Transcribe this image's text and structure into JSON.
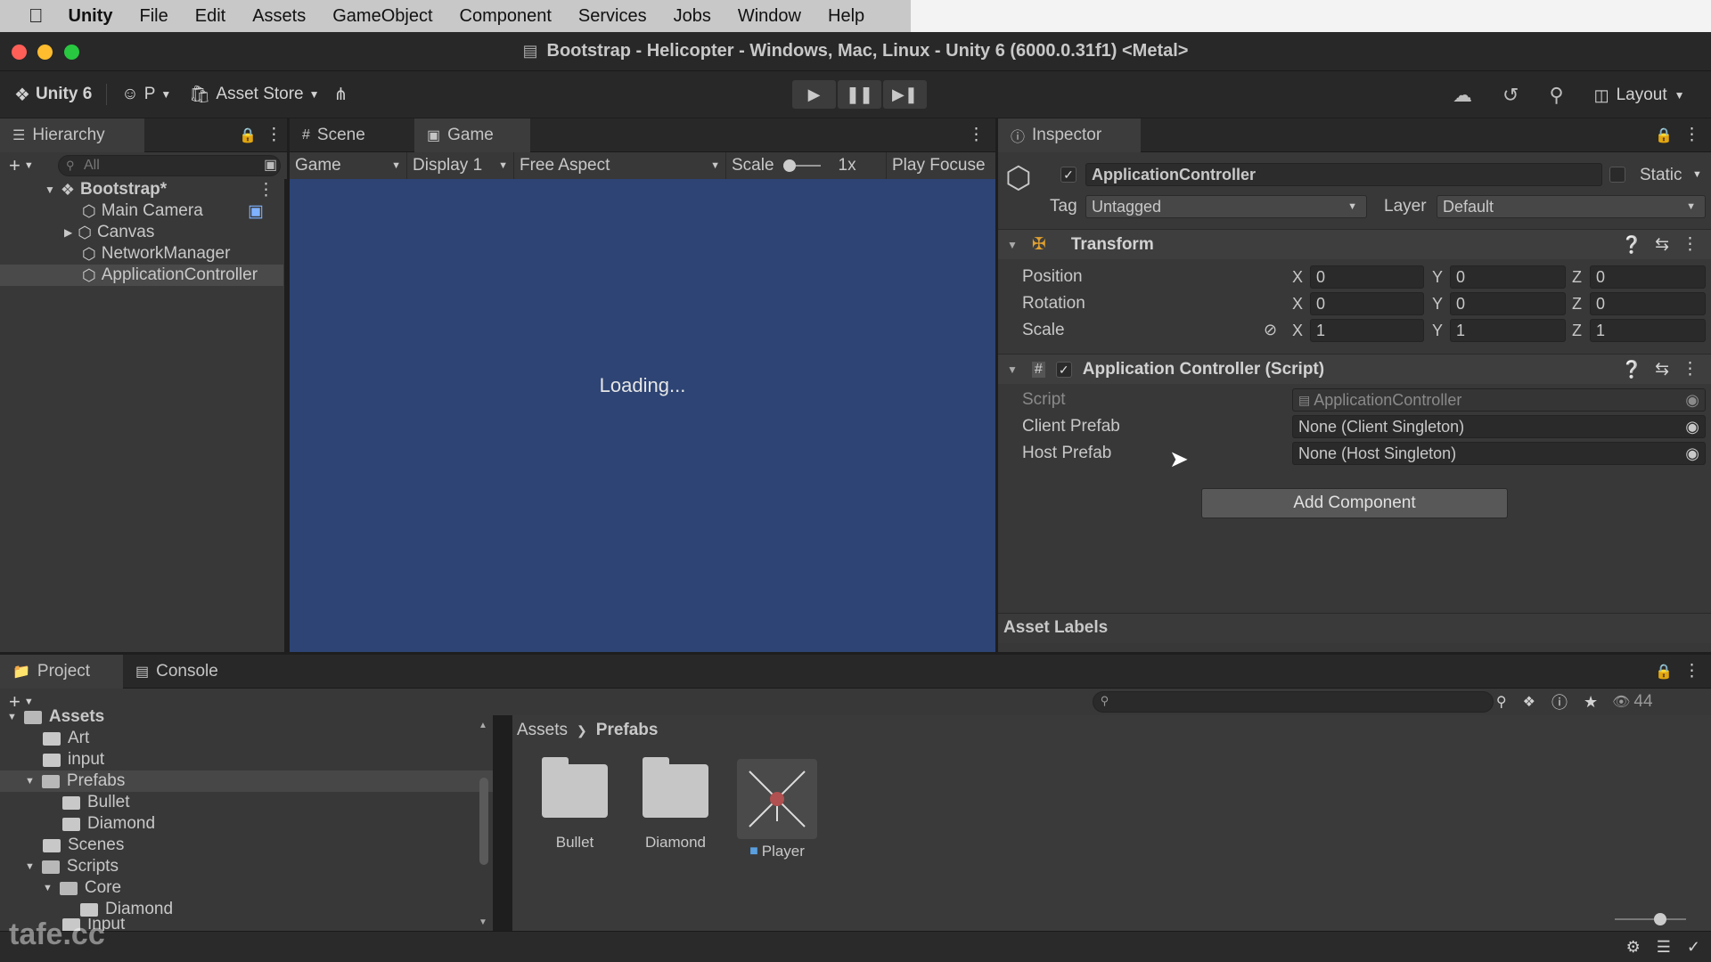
{
  "menubar": {
    "apple": "",
    "items": [
      "Unity",
      "File",
      "Edit",
      "Assets",
      "GameObject",
      "Component",
      "Services",
      "Jobs",
      "Window",
      "Help"
    ]
  },
  "window": {
    "title": "Bootstrap - Helicopter - Windows, Mac, Linux - Unity 6 (6000.0.31f1) <Metal>"
  },
  "toolbar": {
    "unity_label": "Unity 6",
    "account_label": "P",
    "asset_store_label": "Asset Store",
    "layout_label": "Layout"
  },
  "hierarchy": {
    "tab_label": "Hierarchy",
    "search_placeholder": "All",
    "scene": "Bootstrap*",
    "items": [
      "Main Camera",
      "Canvas",
      "NetworkManager",
      "ApplicationController"
    ]
  },
  "game": {
    "tabs": [
      "Scene",
      "Game"
    ],
    "view_mode": "Game",
    "display": "Display 1",
    "aspect": "Free Aspect",
    "scale_label": "Scale",
    "scale_value": "1x",
    "play_focused": "Play Focuse",
    "loading_text": "Loading..."
  },
  "inspector": {
    "tab_label": "Inspector",
    "object_name": "ApplicationController",
    "static_label": "Static",
    "tag_label": "Tag",
    "tag_value": "Untagged",
    "layer_label": "Layer",
    "layer_value": "Default",
    "transform": {
      "title": "Transform",
      "rows": [
        {
          "label": "Position",
          "x": "0",
          "y": "0",
          "z": "0"
        },
        {
          "label": "Rotation",
          "x": "0",
          "y": "0",
          "z": "0"
        },
        {
          "label": "Scale",
          "x": "1",
          "y": "1",
          "z": "1"
        }
      ],
      "axis_x": "X",
      "axis_y": "Y",
      "axis_z": "Z"
    },
    "script_component": {
      "title": "Application Controller (Script)",
      "script_label": "Script",
      "script_value": "ApplicationController",
      "client_prefab_label": "Client Prefab",
      "client_prefab_value": "None (Client Singleton)",
      "host_prefab_label": "Host Prefab",
      "host_prefab_value": "None (Host Singleton)"
    },
    "add_component": "Add Component",
    "asset_labels": "Asset Labels"
  },
  "project": {
    "tabs": [
      "Project",
      "Console"
    ],
    "badge_count": "44",
    "tree": [
      {
        "label": "Assets",
        "depth": 0
      },
      {
        "label": "Art",
        "depth": 1
      },
      {
        "label": "input",
        "depth": 1
      },
      {
        "label": "Prefabs",
        "depth": 1
      },
      {
        "label": "Bullet",
        "depth": 2
      },
      {
        "label": "Diamond",
        "depth": 2
      },
      {
        "label": "Scenes",
        "depth": 1
      },
      {
        "label": "Scripts",
        "depth": 1
      },
      {
        "label": "Core",
        "depth": 2
      },
      {
        "label": "Diamond",
        "depth": 3
      },
      {
        "label": "Input",
        "depth": 2
      }
    ],
    "breadcrumb": [
      "Assets",
      "Prefabs"
    ],
    "assets": [
      "Bullet",
      "Diamond",
      "Player"
    ]
  },
  "watermark": "tafe.cc",
  "colors": {
    "game_bg": "#2d4474",
    "panel": "#383838",
    "traffic_red": "#ff5f57",
    "traffic_yellow": "#febc2e",
    "traffic_green": "#28c840"
  }
}
